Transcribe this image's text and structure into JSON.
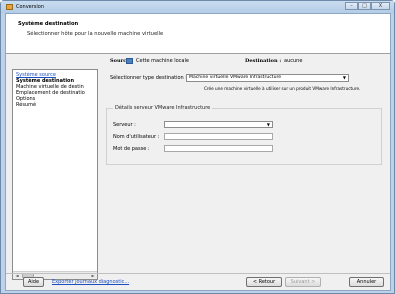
{
  "window": {
    "title": "Conversion",
    "controls": {
      "minimize": "–",
      "maximize": "□",
      "close": "X"
    }
  },
  "header": {
    "title": "Système destination",
    "subtitle": "Sélectionner hôte pour la nouvelle machine virtuelle"
  },
  "sidebar": {
    "items": [
      {
        "label": "Système source",
        "style": "link"
      },
      {
        "label": "Système destination",
        "style": "bold"
      },
      {
        "label": "Machine virtuelle de destin",
        "style": "normal"
      },
      {
        "label": "Emplacement de destinatio",
        "style": "normal"
      },
      {
        "label": "Options",
        "style": "normal"
      },
      {
        "label": "Résumé",
        "style": "normal"
      }
    ],
    "scroll_left": "◄",
    "scroll_right": "►"
  },
  "main": {
    "source_label": "Source :",
    "source_value": "Cette machine locale",
    "destination_label": "Destination :",
    "destination_value": "aucune",
    "dest_type_label": "Sélectionner type destination :",
    "dest_type_value": "Machine virtuelle VMware Infrastructure",
    "dest_type_help": "Crée une machine virtuelle à utiliser sur un produit VMware Infrastructure.",
    "server_group_title": "Détails serveur VMware Infrastructure",
    "server_label": "Serveur :",
    "server_value": "",
    "username_label": "Nom d'utilisateur :",
    "username_value": "",
    "password_label": "Mot de passe :",
    "password_value": ""
  },
  "footer": {
    "help_label": "Aide",
    "export_label": "Exporter journaux diagnostic...",
    "back_label": "< Retour",
    "next_label": "Suivant >",
    "cancel_label": "Annuler"
  },
  "colors": {
    "link": "#1b4fbf",
    "chrome": "#bcd2ea",
    "panel": "#f0f0f0"
  }
}
